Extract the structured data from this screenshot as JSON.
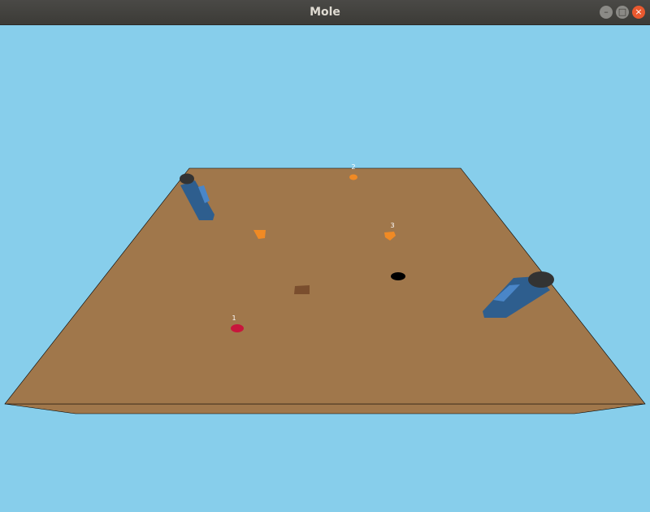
{
  "window": {
    "title": "Mole",
    "minimize_symbol": "–",
    "maximize_symbol": "□",
    "close_symbol": "×"
  },
  "scene": {
    "sky_color": "#87CEEB",
    "ground_color": "#A0774B",
    "hole_color": "#000000",
    "crate_color": "#7A4E2E",
    "player_color": "#2E5E8E",
    "player_accent_color": "#4A86C8",
    "head_color": "#333333",
    "markers": [
      {
        "label": "1",
        "color": "#C8163C"
      },
      {
        "label": "2",
        "color": "#F08A24"
      },
      {
        "label": "3",
        "color": "#F08A24"
      }
    ]
  }
}
